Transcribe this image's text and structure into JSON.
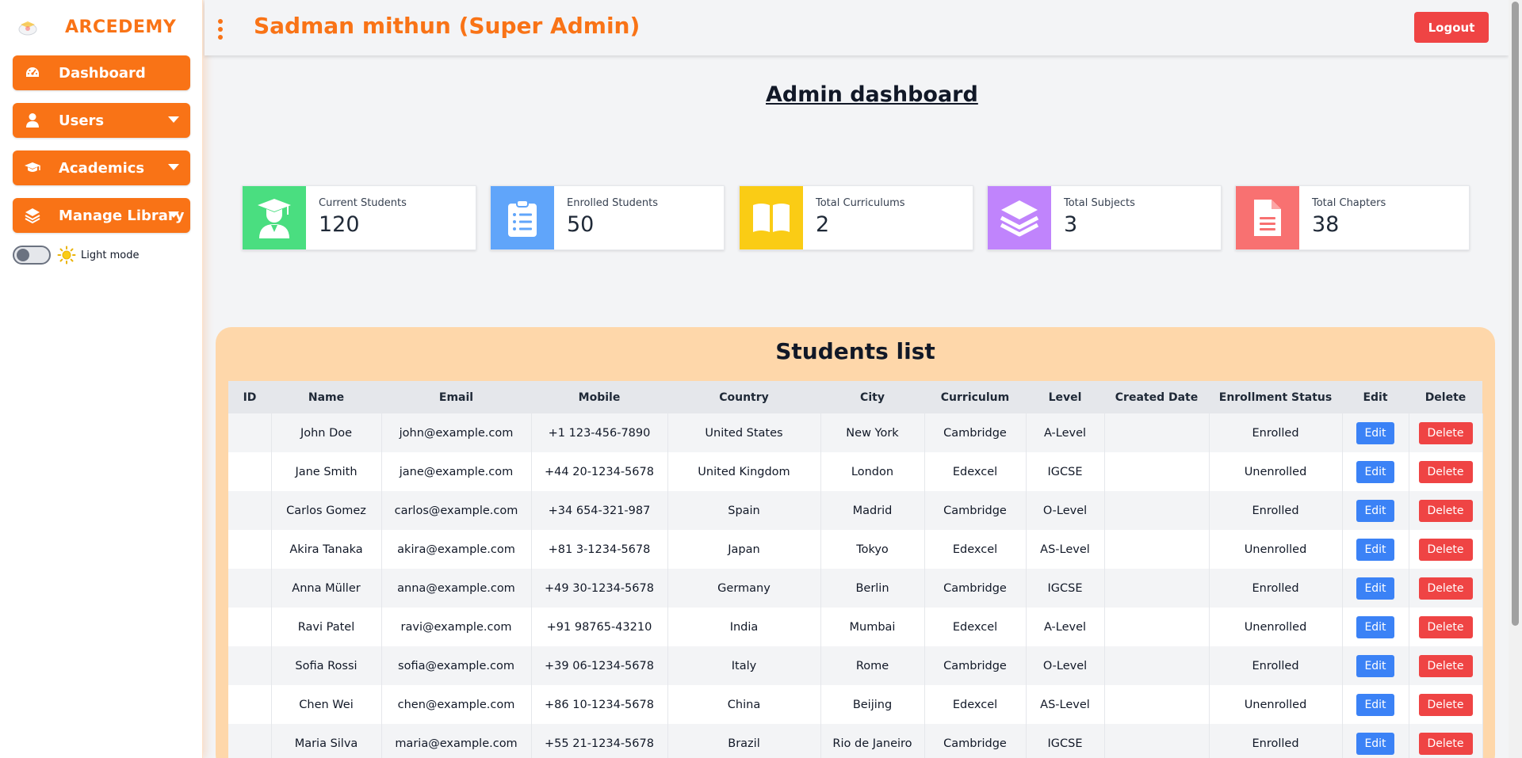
{
  "brand": {
    "name": "ARCEDEMY"
  },
  "sidebar": {
    "items": [
      {
        "label": "Dashboard",
        "icon": "gauge-icon"
      },
      {
        "label": "Users",
        "icon": "user-icon"
      },
      {
        "label": "Academics",
        "icon": "graduation-cap-icon"
      },
      {
        "label": "Manage Library",
        "icon": "layers-icon"
      }
    ],
    "mode_label": "Light mode"
  },
  "header": {
    "title": "Sadman mithun (Super Admin)",
    "logout_label": "Logout"
  },
  "main": {
    "title": "Admin dashboard",
    "stats": [
      {
        "label": "Current Students",
        "value": "120",
        "color": "#4ade80",
        "icon": "student-icon"
      },
      {
        "label": "Enrolled Students",
        "value": "50",
        "color": "#60a5fa",
        "icon": "clipboard-list-icon"
      },
      {
        "label": "Total Curriculums",
        "value": "2",
        "color": "#facc15",
        "icon": "book-open-icon"
      },
      {
        "label": "Total Subjects",
        "value": "3",
        "color": "#c084fc",
        "icon": "layers-icon"
      },
      {
        "label": "Total Chapters",
        "value": "38",
        "color": "#f87171",
        "icon": "document-icon"
      }
    ]
  },
  "students": {
    "title": "Students list",
    "columns": [
      "ID",
      "Name",
      "Email",
      "Mobile",
      "Country",
      "City",
      "Curriculum",
      "Level",
      "Created Date",
      "Enrollment Status",
      "Edit",
      "Delete"
    ],
    "edit_label": "Edit",
    "delete_label": "Delete",
    "rows": [
      {
        "name": "John Doe",
        "email": "john@example.com",
        "mobile": "+1 123-456-7890",
        "country": "United States",
        "city": "New York",
        "curriculum": "Cambridge",
        "level": "A-Level",
        "status": "Enrolled"
      },
      {
        "name": "Jane Smith",
        "email": "jane@example.com",
        "mobile": "+44 20-1234-5678",
        "country": "United Kingdom",
        "city": "London",
        "curriculum": "Edexcel",
        "level": "IGCSE",
        "status": "Unenrolled"
      },
      {
        "name": "Carlos Gomez",
        "email": "carlos@example.com",
        "mobile": "+34 654-321-987",
        "country": "Spain",
        "city": "Madrid",
        "curriculum": "Cambridge",
        "level": "O-Level",
        "status": "Enrolled"
      },
      {
        "name": "Akira Tanaka",
        "email": "akira@example.com",
        "mobile": "+81 3-1234-5678",
        "country": "Japan",
        "city": "Tokyo",
        "curriculum": "Edexcel",
        "level": "AS-Level",
        "status": "Unenrolled"
      },
      {
        "name": "Anna Müller",
        "email": "anna@example.com",
        "mobile": "+49 30-1234-5678",
        "country": "Germany",
        "city": "Berlin",
        "curriculum": "Cambridge",
        "level": "IGCSE",
        "status": "Enrolled"
      },
      {
        "name": "Ravi Patel",
        "email": "ravi@example.com",
        "mobile": "+91 98765-43210",
        "country": "India",
        "city": "Mumbai",
        "curriculum": "Edexcel",
        "level": "A-Level",
        "status": "Unenrolled"
      },
      {
        "name": "Sofia Rossi",
        "email": "sofia@example.com",
        "mobile": "+39 06-1234-5678",
        "country": "Italy",
        "city": "Rome",
        "curriculum": "Cambridge",
        "level": "O-Level",
        "status": "Enrolled"
      },
      {
        "name": "Chen Wei",
        "email": "chen@example.com",
        "mobile": "+86 10-1234-5678",
        "country": "China",
        "city": "Beijing",
        "curriculum": "Edexcel",
        "level": "AS-Level",
        "status": "Unenrolled"
      },
      {
        "name": "Maria Silva",
        "email": "maria@example.com",
        "mobile": "+55 21-1234-5678",
        "country": "Brazil",
        "city": "Rio de Janeiro",
        "curriculum": "Cambridge",
        "level": "IGCSE",
        "status": "Enrolled"
      }
    ]
  }
}
